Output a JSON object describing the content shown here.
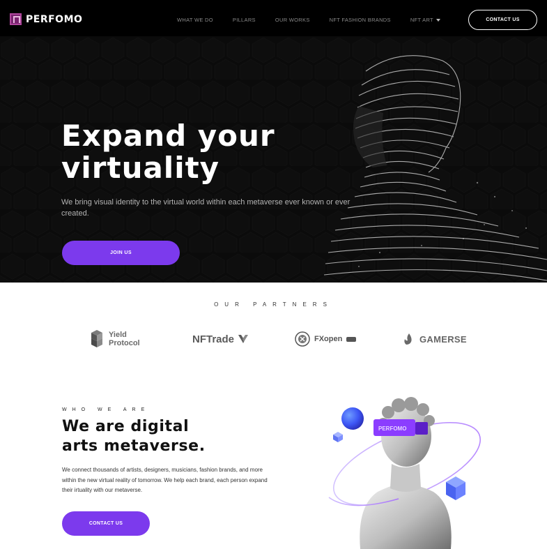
{
  "nav": {
    "brand": "PERFOMO",
    "links": [
      "WHAT WE DO",
      "PILLARS",
      "OUR WORKS",
      "NFT FASHION BRANDS",
      "NFT ART"
    ],
    "cta": "CONTACT US"
  },
  "hero": {
    "title_line1": "Expand your",
    "title_line2": "virtuality",
    "subtitle": "We bring visual identity to the virtual world within each metaverse ever known or ever created.",
    "button": "JOIN US"
  },
  "partners": {
    "title": "OUR PARTNERS",
    "items": [
      {
        "line1": "Yield",
        "line2": "Protocol",
        "icon": "yield-cubes-icon"
      },
      {
        "name": "NFTrade",
        "icon": "nftrade-arrow-icon"
      },
      {
        "name": "FXopen",
        "icon": "fxopen-crest-icon"
      },
      {
        "name": "GAMERSE",
        "icon": "gamerse-flame-icon"
      }
    ]
  },
  "who": {
    "label": "WHO WE ARE",
    "title_line1": "We are digital",
    "title_line2": "arts metaverse.",
    "text": "We connect thousands of artists, designers, musicians, fashion brands, and more within the new virtual reality of tomorrow. We help each brand, each person expand their irtuality with our metaverse.",
    "button": "CONTACT US",
    "badge": "PERFOMO"
  },
  "colors": {
    "accent": "#7c3aed",
    "nav_bg": "#000000",
    "hero_bg": "#0b0b0b"
  }
}
